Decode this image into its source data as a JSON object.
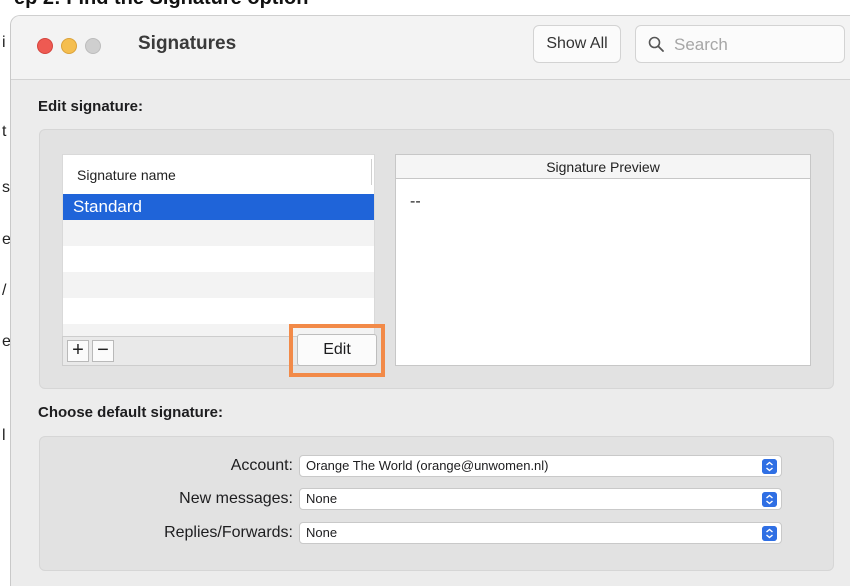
{
  "background": {
    "top_text": "ep 2: Find the Signature option",
    "left_glyphs": [
      "i",
      "t",
      "s",
      "e",
      "/",
      "e",
      "l"
    ]
  },
  "window": {
    "title": "Signatures",
    "show_all_label": "Show All",
    "search_placeholder": "Search"
  },
  "edit_section": {
    "label": "Edit signature:",
    "list_header": "Signature name",
    "signatures": [
      "Standard"
    ],
    "add_label": "+",
    "remove_label": "−",
    "edit_label": "Edit",
    "preview_header": "Signature Preview",
    "preview_text": "--"
  },
  "default_section": {
    "label": "Choose default signature:",
    "fields": [
      {
        "label": "Account:",
        "value": "Orange The World (orange@unwomen.nl)"
      },
      {
        "label": "New messages:",
        "value": "None"
      },
      {
        "label": "Replies/Forwards:",
        "value": "None"
      }
    ]
  },
  "colors": {
    "selection": "#1f64d9",
    "highlight": "#f28a48",
    "popup_accent": "#2f6fe4"
  }
}
